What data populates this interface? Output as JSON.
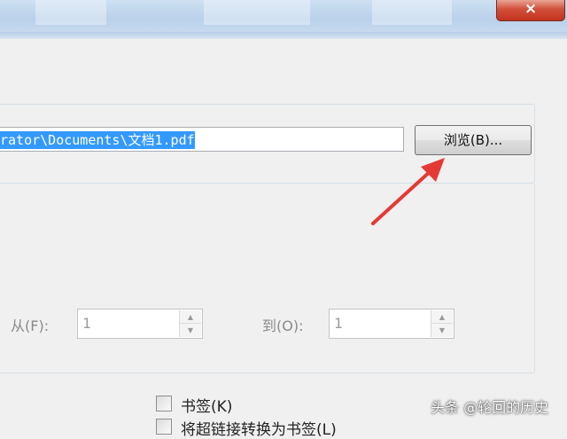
{
  "window": {
    "close_glyph": "×"
  },
  "output": {
    "file_path": "rator\\Documents\\文档1.pdf",
    "browse_label": "浏览(B)..."
  },
  "range": {
    "from_label": "从(F):",
    "from_value": "1",
    "to_label": "到(O):",
    "to_value": "1"
  },
  "options": {
    "bookmarks_label": "书签(K)",
    "second_label": "将超链接转换为书签(L)"
  },
  "watermark": "头条 @轮回的历史",
  "colors": {
    "selection": "#3399ff",
    "arrow": "#e53935",
    "close": "#c3321e"
  }
}
